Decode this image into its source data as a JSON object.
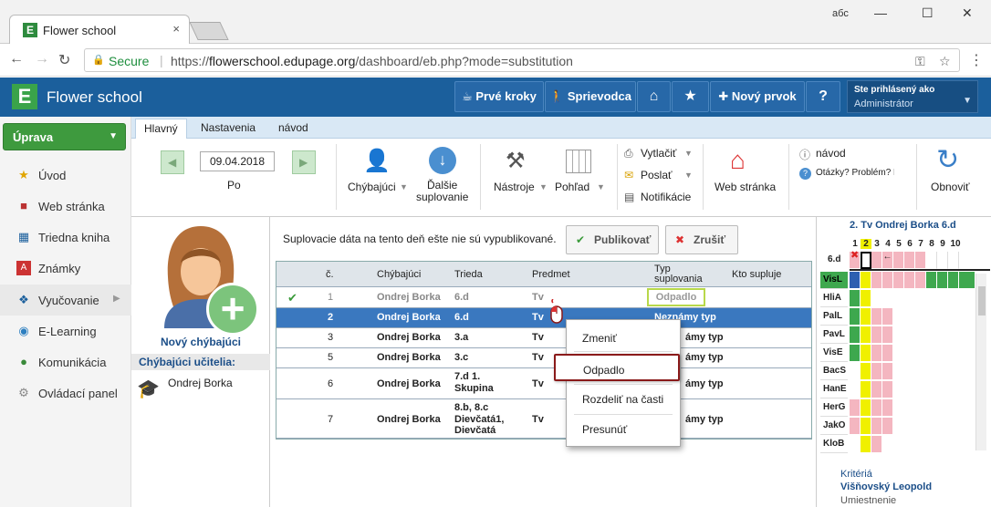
{
  "browser": {
    "tab_title": "Flower school",
    "tab_close": "×",
    "secure_label": "Secure",
    "url_scheme": "https://",
    "url_host": "flowerschool.edupage.org",
    "url_path": "/dashboard/eb.php?mode=substitution",
    "window_user_badge": "aбc"
  },
  "header": {
    "logo_letter": "E",
    "app_title": "Flower school",
    "buttons": {
      "first_steps": "Prvé kroky",
      "guide": "Sprievodca",
      "new_item": "Nový prvok",
      "help": "?"
    },
    "user_line1": "Ste prihlásený ako",
    "user_line2": "Administrátor"
  },
  "sidebar": {
    "edit_button": "Úprava",
    "items": [
      {
        "label": "Úvod",
        "icon": "star-icon"
      },
      {
        "label": "Web stránka",
        "icon": "web-icon"
      },
      {
        "label": "Triedna kniha",
        "icon": "book-icon"
      },
      {
        "label": "Známky",
        "icon": "grades-icon"
      },
      {
        "label": "Vyučovanie",
        "icon": "teaching-icon"
      },
      {
        "label": "E-Learning",
        "icon": "elearning-icon"
      },
      {
        "label": "Komunikácia",
        "icon": "communication-icon"
      },
      {
        "label": "Ovládací panel",
        "icon": "control-panel-icon"
      }
    ]
  },
  "ribbon": {
    "tabs": [
      "Hlavný",
      "Nastavenia",
      "návod"
    ],
    "date": "09.04.2018",
    "day": "Po",
    "absent": "Chýbajúci",
    "next_sub_l1": "Ďalšie",
    "next_sub_l2": "suplovanie",
    "tools": "Nástroje",
    "view": "Pohľad",
    "print": "Vytlačiť",
    "send": "Poslať",
    "notifications": "Notifikácie",
    "website": "Web stránka",
    "guide": "návod",
    "question": "Otázky? Problém? N",
    "refresh": "Obnoviť"
  },
  "left_panel": {
    "new_absent": "Nový chýbajúci",
    "absent_teachers_head": "Chýbajúci učitelia:",
    "teacher": "Ondrej Borka"
  },
  "main": {
    "notice": "Suplovacie dáta na tento deň ešte nie sú vypublikované.",
    "publish": "Publikovať",
    "cancel": "Zrušiť",
    "columns": {
      "num": "č.",
      "absent": "Chýbajúci",
      "class": "Trieda",
      "subject": "Predmet",
      "type_l1": "Typ",
      "type_l2": "suplovania",
      "who": "Kto supluje"
    },
    "rows": [
      {
        "num": "1",
        "absent": "Ondrej Borka",
        "class1": "6.d",
        "class2": "",
        "class3": "",
        "subject": "Tv",
        "type": "Odpadlo"
      },
      {
        "num": "2",
        "absent": "Ondrej Borka",
        "class1": "6.d",
        "class2": "",
        "class3": "",
        "subject": "Tv",
        "type": "Neznámy typ"
      },
      {
        "num": "3",
        "absent": "Ondrej Borka",
        "class1": "3.a",
        "class2": "",
        "class3": "",
        "subject": "Tv",
        "type": "ámy typ"
      },
      {
        "num": "5",
        "absent": "Ondrej Borka",
        "class1": "3.c",
        "class2": "",
        "class3": "",
        "subject": "Tv",
        "type": "ámy typ"
      },
      {
        "num": "6",
        "absent": "Ondrej Borka",
        "class1": "7.d 1.",
        "class2": "Skupina",
        "class3": "",
        "subject": "Tv",
        "type": "ámy typ"
      },
      {
        "num": "7",
        "absent": "Ondrej Borka",
        "class1": "8.b, 8.c",
        "class2": "Dievčatá1,",
        "class3": "Dievčatá",
        "subject": "Tv",
        "type": "ámy typ"
      }
    ]
  },
  "context_menu": {
    "items": [
      "Zmeniť",
      "Odpadlo",
      "Rozdeliť na časti",
      "Presunúť"
    ]
  },
  "right_panel": {
    "title": "2. Tv Ondrej Borka 6.d",
    "hours": [
      "1",
      "2",
      "3",
      "4",
      "5",
      "6",
      "7",
      "8",
      "9",
      "10"
    ],
    "class_label": "6.d",
    "arrow": "←",
    "teachers": [
      "VisL",
      "HliA",
      "PalL",
      "PavL",
      "VisE",
      "BacS",
      "HanE",
      "HerG",
      "JakO",
      "KloB"
    ],
    "criteria": "Kritériá",
    "criteria_name": "Višňovský Leopold",
    "placement": "Umiestnenie"
  },
  "colors": {
    "header": "#1b5f9c",
    "selected_row": "#3a78bf",
    "green": "#3e9a3e",
    "pink": "#f4b6c0",
    "yellow": "#f0f000"
  }
}
